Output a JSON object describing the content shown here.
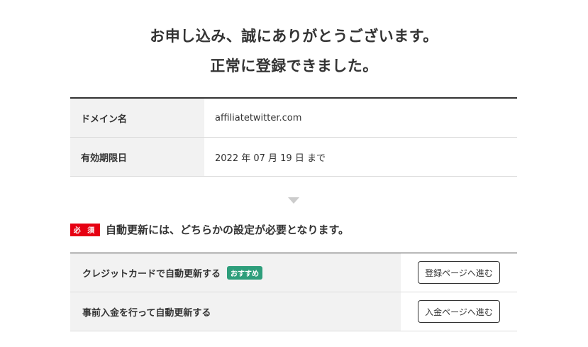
{
  "header": {
    "line1": "お申し込み、誠にありがとうございます。",
    "line2": "正常に登録できました。"
  },
  "info": {
    "rows": [
      {
        "label": "ドメイン名",
        "value": "affiliatetwitter.com"
      },
      {
        "label": "有効期限日",
        "value": "2022 年 07 月 19 日 まで"
      }
    ]
  },
  "notice": {
    "badge": "必 須",
    "text": "自動更新には、どちらかの設定が必要となります。"
  },
  "options": [
    {
      "label": "クレジットカードで自動更新する",
      "badge": "おすすめ",
      "button": "登録ページへ進む"
    },
    {
      "label": "事前入金を行って自動更新する",
      "button": "入金ページへ進む"
    }
  ],
  "colors": {
    "required_badge": "#e60012",
    "recommend_badge": "#2e9e7b",
    "label_background": "#f2f2f2"
  },
  "icons": {
    "separator": "arrow-down-icon"
  }
}
